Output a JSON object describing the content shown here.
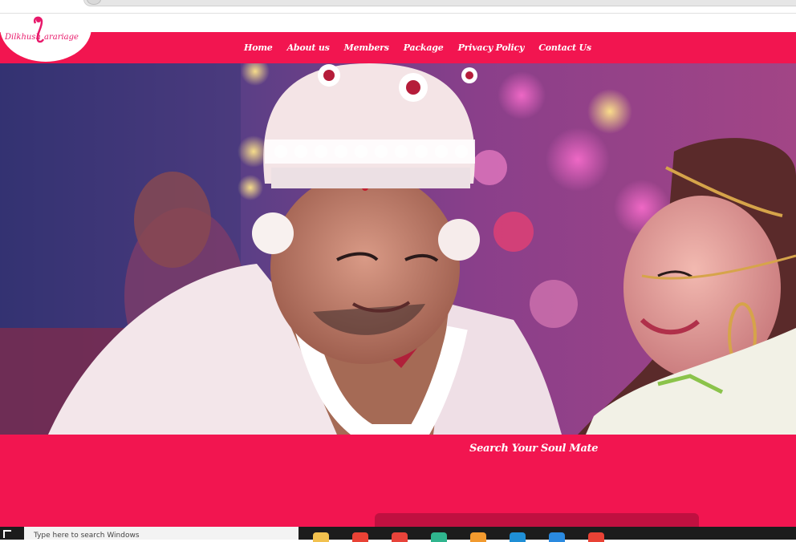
{
  "site": {
    "logo_text": "Dilkhush Marriage"
  },
  "nav": {
    "items": [
      "Home",
      "About us",
      "Members",
      "Package",
      "Privacy Policy",
      "Contact Us"
    ]
  },
  "hero": {
    "image_name": "wedding-couple-photo"
  },
  "search": {
    "title": "Search Your Soul Mate"
  },
  "taskbar": {
    "search_placeholder": "Type here to search Windows",
    "apps": [
      "file-explorer-icon",
      "chrome-icon",
      "office-icon",
      "edge-icon",
      "store-icon",
      "browser-icon",
      "vscode-icon",
      "chrome-icon"
    ],
    "colors": {
      "file-explorer-icon": "#f2c14e",
      "chrome-icon": "#e94235",
      "office-icon": "#e8433a",
      "edge-icon": "#2fb58e",
      "store-icon": "#f29a2e",
      "browser-icon": "#1f8fd6",
      "vscode-icon": "#2a8ae0"
    }
  },
  "theme": {
    "brand": "#f21550",
    "brand_dark": "#c01040"
  }
}
